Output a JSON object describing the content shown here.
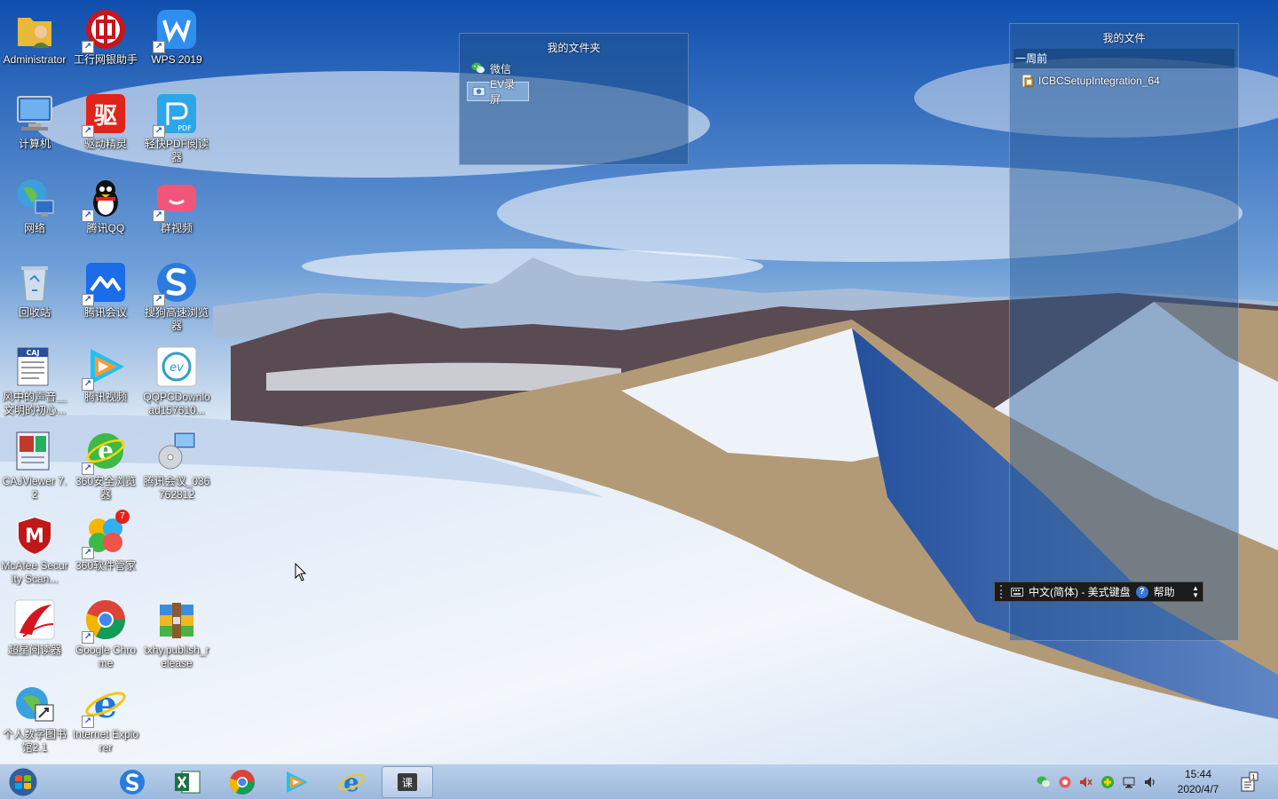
{
  "desktop": {
    "icons": [
      {
        "label": "Administrator",
        "icon": "user-folder-icon",
        "shortcut": false
      },
      {
        "label": "工行网银助手",
        "icon": "icbc-icon",
        "shortcut": true
      },
      {
        "label": "WPS 2019",
        "icon": "wps-icon",
        "shortcut": true
      },
      {
        "label": "计算机",
        "icon": "computer-icon",
        "shortcut": false
      },
      {
        "label": "驱动精灵",
        "icon": "driver-genius-icon",
        "shortcut": true
      },
      {
        "label": "轻快PDF阅读器",
        "icon": "pdf-reader-icon",
        "shortcut": true
      },
      {
        "label": "网络",
        "icon": "network-icon",
        "shortcut": false
      },
      {
        "label": "腾讯QQ",
        "icon": "qq-penguin-icon",
        "shortcut": true
      },
      {
        "label": "群视频",
        "icon": "group-video-icon",
        "shortcut": true
      },
      {
        "label": "回收站",
        "icon": "recycle-bin-icon",
        "shortcut": false
      },
      {
        "label": "腾讯会议",
        "icon": "tencent-meeting-icon",
        "shortcut": true
      },
      {
        "label": "搜狗高速浏览器",
        "icon": "sogou-browser-icon",
        "shortcut": true
      },
      {
        "label": "风中的声音＿文明的初心...",
        "icon": "caj-document-icon",
        "shortcut": false
      },
      {
        "label": "腾讯视频",
        "icon": "tencent-video-icon",
        "shortcut": true
      },
      {
        "label": "QQPCDownload157610...",
        "icon": "installer-icon",
        "shortcut": false
      },
      {
        "label": "CAJViewer 7.2",
        "icon": "cajviewer-icon",
        "shortcut": false
      },
      {
        "label": "360安全浏览器",
        "icon": "360-browser-icon",
        "shortcut": true
      },
      {
        "label": "腾讯会议_036762812",
        "icon": "setup-disc-icon",
        "shortcut": false
      },
      {
        "label": "McAfee Security Scan...",
        "icon": "mcafee-icon",
        "shortcut": false
      },
      {
        "label": "360软件管家",
        "icon": "360-software-manager-icon",
        "shortcut": true
      },
      {
        "label": "超星阅读器",
        "icon": "superstar-reader-icon",
        "shortcut": false
      },
      {
        "label": "Google Chrome",
        "icon": "chrome-icon",
        "shortcut": true
      },
      {
        "label": "txhy.publish_release",
        "icon": "winrar-archive-icon",
        "shortcut": false
      },
      {
        "label": "个人数字图书馆2.1",
        "icon": "digital-library-icon",
        "shortcut": false
      },
      {
        "label": "Internet Explorer",
        "icon": "ie-icon",
        "shortcut": true
      }
    ],
    "badge_360": "7"
  },
  "fence_folder": {
    "title": "我的文件夹",
    "items": [
      {
        "label": "微信",
        "icon": "wechat-icon",
        "selected": false
      },
      {
        "label": "EV录屏",
        "icon": "ev-recorder-icon",
        "selected": true
      }
    ]
  },
  "fence_files": {
    "title": "我的文件",
    "group": "一周前",
    "items": [
      {
        "label": "ICBCSetupIntegration_64",
        "icon": "setup-file-icon"
      }
    ]
  },
  "ime_bar": {
    "language": "中文(简体) - 美式键盘",
    "help": "帮助",
    "help_icon": "?"
  },
  "taskbar": {
    "apps": [
      {
        "name": "sogou-browser",
        "icon": "sogou-browser-icon"
      },
      {
        "name": "excel",
        "icon": "excel-icon"
      },
      {
        "name": "chrome",
        "icon": "chrome-icon"
      },
      {
        "name": "tencent-video",
        "icon": "tencent-video-icon"
      },
      {
        "name": "internet-explorer",
        "icon": "ie-icon"
      },
      {
        "name": "course",
        "icon": "course-app-icon",
        "active": true
      }
    ],
    "course_glyph": "课",
    "clock_time": "15:44",
    "clock_date": "2020/4/7",
    "notification_count": "1"
  },
  "colors": {
    "sky_top": "#1a5bb8",
    "snow": "#eaf1fb",
    "taskbar": "#9cb8dc"
  }
}
